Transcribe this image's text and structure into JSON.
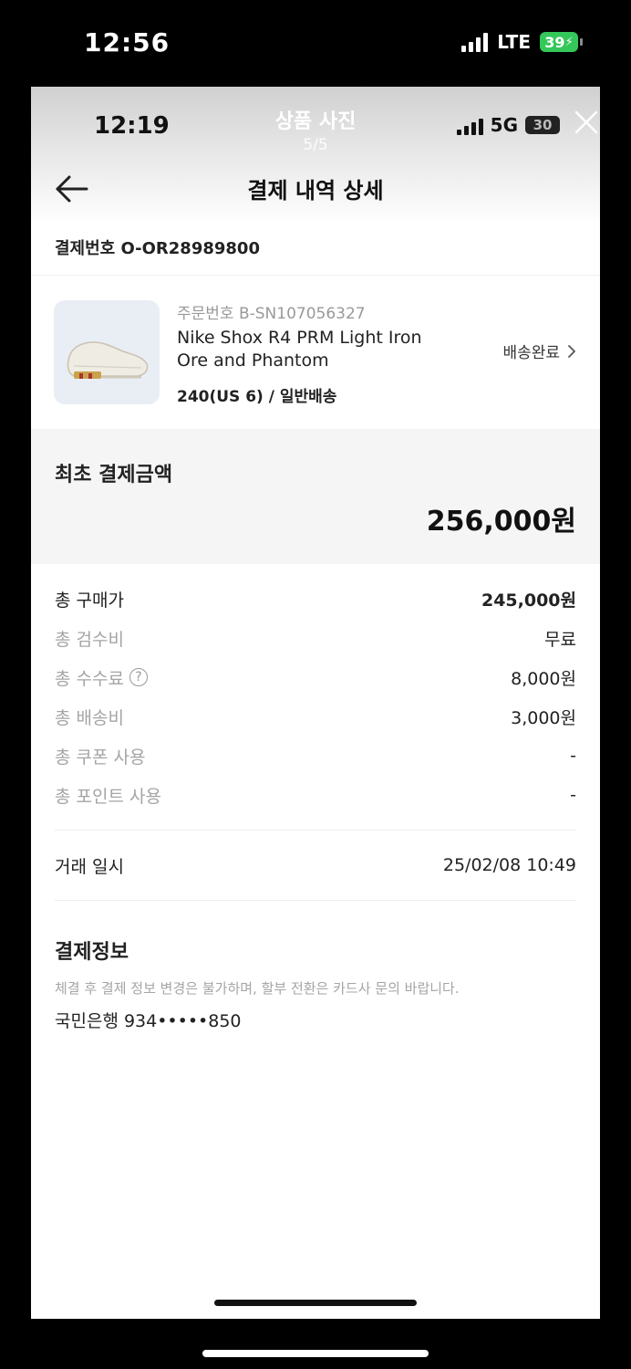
{
  "outer_status": {
    "time": "12:56",
    "network": "LTE",
    "battery": "39"
  },
  "viewer": {
    "title": "상품 사진",
    "counter": "5/5",
    "close_icon": "close-icon"
  },
  "inner_status": {
    "time": "12:19",
    "network": "5G",
    "battery": "30"
  },
  "nav": {
    "title": "결제 내역 상세",
    "back_icon": "arrow-left-icon"
  },
  "payment_number": "결제번호 O-OR28989800",
  "product": {
    "order_number": "주문번호 B-SN107056327",
    "name": "Nike Shox R4 PRM Light Iron Ore and Phantom",
    "option": "240(US 6) / 일반배송",
    "status": "배송완료",
    "image_icon": "sneaker-image"
  },
  "total": {
    "label": "최초 결제금액",
    "amount": "256,000원"
  },
  "breakdown": [
    {
      "label": "총 구매가",
      "value": "245,000원"
    },
    {
      "label": "총 검수비",
      "value": "무료"
    },
    {
      "label": "총 수수료",
      "value": "8,000원"
    },
    {
      "label": "총 배송비",
      "value": "3,000원"
    },
    {
      "label": "총 쿠폰 사용",
      "value": "-"
    },
    {
      "label": "총 포인트 사용",
      "value": "-"
    }
  ],
  "transaction": {
    "label": "거래 일시",
    "value": "25/02/08 10:49"
  },
  "payment_info": {
    "title": "결제정보",
    "note": "체결 후 결제 정보 변경은 불가하며, 할부 전환은 카드사 문의 바랍니다.",
    "card": "국민은행 934•••••850"
  },
  "colors": {
    "battery_green": "#34c759",
    "muted_text": "#a5a5a5",
    "panel_bg": "#f5f5f5"
  }
}
